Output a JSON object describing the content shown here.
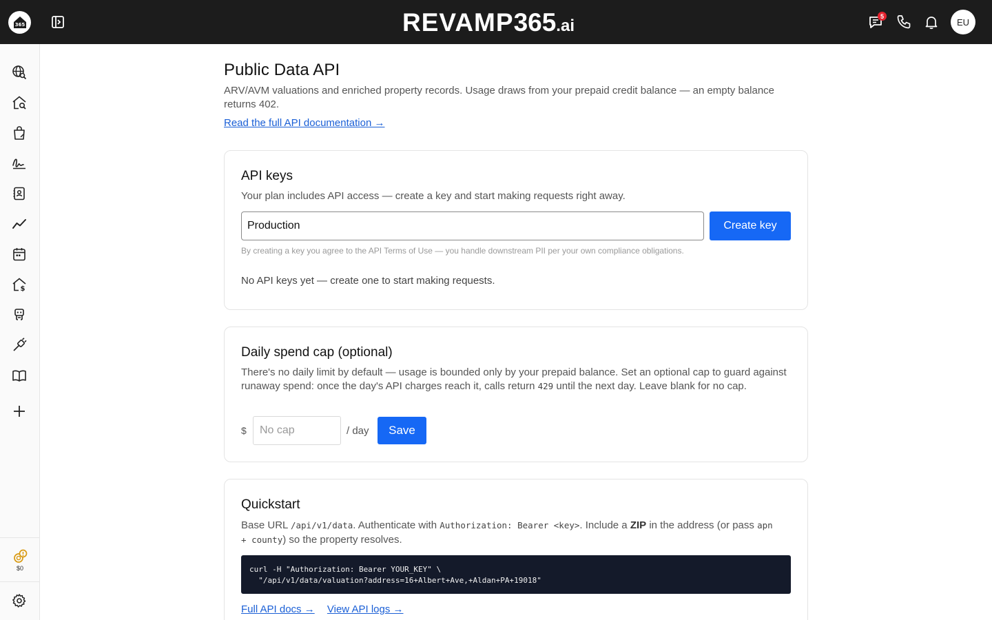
{
  "header": {
    "brand_main": "REVAMP",
    "brand_num": "365",
    "brand_ai": ".ai",
    "chat_badge_count": "5",
    "avatar_initials": "EU",
    "colors": {
      "bar": "#1c1c1c",
      "badge": "#e5232f"
    }
  },
  "sidebar": {
    "items": [
      {
        "icon": "globe-search-icon"
      },
      {
        "icon": "home-search-icon"
      },
      {
        "icon": "shopping-bag-icon"
      },
      {
        "icon": "signature-icon"
      },
      {
        "icon": "contacts-book-icon"
      },
      {
        "icon": "trend-line-icon"
      },
      {
        "icon": "calendar-icon"
      },
      {
        "icon": "home-dollar-icon"
      },
      {
        "icon": "robot-icon"
      },
      {
        "icon": "plug-icon"
      },
      {
        "icon": "book-icon"
      },
      {
        "icon": "plus-icon"
      }
    ],
    "credits_label": "$0",
    "settings_icon": "gear-icon"
  },
  "page": {
    "title": "Public Data API",
    "subtitle": "ARV/AVM valuations and enriched property records. Usage draws from your prepaid credit balance — an empty balance returns 402.",
    "doc_link": "Read the full API documentation →"
  },
  "api_keys": {
    "title": "API keys",
    "description": "Your plan includes API access — create a key and start making requests right away.",
    "key_name_value": "Production",
    "create_button": "Create key",
    "fineprint": "By creating a key you agree to the API Terms of Use — you handle downstream PII per your own compliance obligations.",
    "empty_state": "No API keys yet — create one to start making requests."
  },
  "spend_cap": {
    "title": "Daily spend cap (optional)",
    "description_1": "There's no daily limit by default — usage is bounded only by your prepaid balance. Set an optional cap to guard against runaway spend: once the day's API charges reach it, calls return ",
    "code_429": "429",
    "description_2": " until the next day. Leave blank for no cap.",
    "currency": "$",
    "input_placeholder": "No cap",
    "per_day": "/ day",
    "save_button": "Save"
  },
  "quickstart": {
    "title": "Quickstart",
    "t1": "Base URL ",
    "base_url": "/api/v1/data",
    "t2": ". Authenticate with ",
    "auth_header": "Authorization: Bearer <key>",
    "t3": ". Include a ",
    "zip": "ZIP",
    "t4": " in the address (or pass ",
    "apn": "apn",
    "t5": "+ ",
    "county": "county",
    "t6": ") so the property resolves.",
    "code_line_1": "curl -H \"Authorization: Bearer YOUR_KEY\" \\",
    "code_line_2": "  \"/api/v1/data/valuation?address=16+Albert+Ave,+Aldan+PA+19018\"",
    "link_docs": "Full API docs →",
    "link_logs": "View API logs →"
  },
  "accent_color": "#1668f5"
}
